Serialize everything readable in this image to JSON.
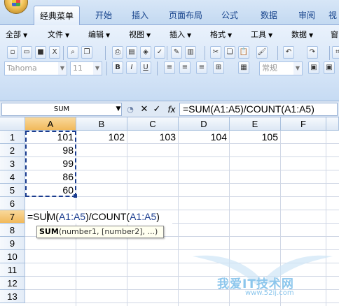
{
  "ribbon_tabs": [
    "经典菜单",
    "开始",
    "插入",
    "页面布局",
    "公式",
    "数据",
    "审阅",
    "视"
  ],
  "menu_items": [
    "全部",
    "文件",
    "编辑",
    "视图",
    "插入",
    "格式",
    "工具",
    "数据",
    "窗"
  ],
  "font": {
    "name": "Tahoma",
    "size": "11"
  },
  "number_format": "常规",
  "name_box": "SUM",
  "formula_bar": "=SUM(A1:A5)/COUNT(A1:A5)",
  "columns": [
    "A",
    "B",
    "C",
    "D",
    "E",
    "F"
  ],
  "rows": [
    "1",
    "2",
    "3",
    "4",
    "5",
    "6",
    "7",
    "8",
    "9",
    "10",
    "11",
    "12",
    "13"
  ],
  "cells": {
    "A1": "101",
    "B1": "102",
    "C1": "103",
    "D1": "104",
    "E1": "105",
    "A2": "98",
    "A3": "99",
    "A4": "86",
    "A5": "60"
  },
  "edit_cell": {
    "part1": "=SU",
    "part2": "M(",
    "ref1": "A1:A5",
    "part3": ")/COUNT(",
    "ref2": "A1:A5",
    "part4": ")"
  },
  "tooltip": {
    "func": "SUM",
    "args": "(number1, [number2], ...)"
  },
  "watermark": {
    "text": "我爱IT技术网",
    "url": "www.52ij.com"
  }
}
